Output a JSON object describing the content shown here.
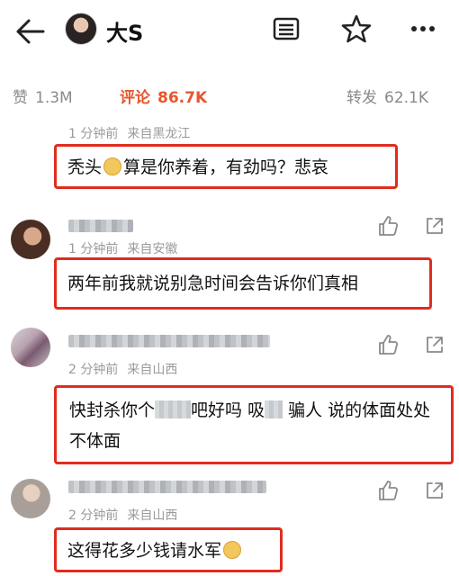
{
  "header": {
    "title": "大S"
  },
  "stats": {
    "likes_label": "赞",
    "likes_value": "1.3M",
    "comments_label": "评论",
    "comments_value": "86.7K",
    "reposts_label": "转发",
    "reposts_value": "62.1K"
  },
  "colors": {
    "accent": "#e8562d",
    "highlight_box": "#e02c20"
  },
  "icons": {
    "back": "arrow-left-icon",
    "list": "list-icon",
    "star": "star-icon",
    "more": "more-icon",
    "like": "thumb-up-icon",
    "share": "share-icon"
  },
  "comments": [
    {
      "time": "1 分钟前",
      "source": "来自黑龙江",
      "text_a": "秃头",
      "text_b": "算是你养着，有劲吗？悲哀"
    },
    {
      "time": "1 分钟前",
      "source": "来自安徽",
      "text": "两年前我就说别急时间会告诉你们真相"
    },
    {
      "time": "2 分钟前",
      "source": "来自山西",
      "text_a": "快封杀你个",
      "text_b": "吧好吗 吸",
      "text_c": " 骗人 说的体面处处不体面"
    },
    {
      "time": "2 分钟前",
      "source": "来自山西",
      "text": "这得花多少钱请水军"
    }
  ]
}
